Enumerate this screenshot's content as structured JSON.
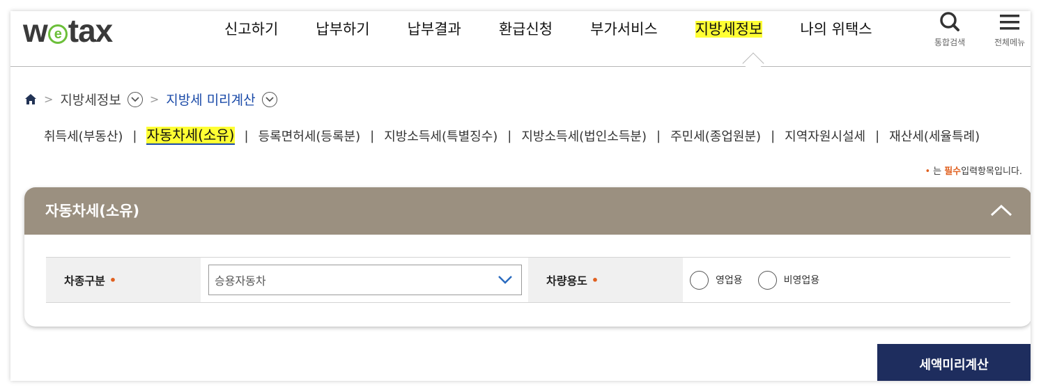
{
  "logo": {
    "pre": "w",
    "mid": "e",
    "post": "tax"
  },
  "gnb": [
    {
      "label": "신고하기",
      "active": false
    },
    {
      "label": "납부하기",
      "active": false
    },
    {
      "label": "납부결과",
      "active": false
    },
    {
      "label": "환급신청",
      "active": false
    },
    {
      "label": "부가서비스",
      "active": false
    },
    {
      "label": "지방세정보",
      "active": true
    },
    {
      "label": "나의 위택스",
      "active": false
    }
  ],
  "util": {
    "search_label": "통합검색",
    "menu_label": "전체메뉴"
  },
  "breadcrumb": {
    "level1": "지방세정보",
    "level2": "지방세 미리계산"
  },
  "subtabs": [
    "취득세(부동산)",
    "자동차세(소유)",
    "등록면허세(등록분)",
    "지방소득세(특별징수)",
    "지방소득세(법인소득분)",
    "주민세(종업원분)",
    "지역자원시설세",
    "재산세(세율특례)"
  ],
  "active_subtab": 1,
  "required_note": {
    "dot": "•",
    "pre": "는",
    "bold": "필수",
    "post": "입력항목입니다."
  },
  "panel": {
    "title": "자동차세(소유)",
    "vehicle_type_label": "차종구분",
    "vehicle_type_value": "승용자동차",
    "usage_label": "차량용도",
    "usage_options": [
      "영업용",
      "비영업용"
    ],
    "required_mark": "•"
  },
  "calc_button": "세액미리계산",
  "colors": {
    "accent": "#1a4aa8",
    "panel_header": "#9b9080",
    "button": "#1e2d5e",
    "required": "#e0601f",
    "highlight": "#ffff33"
  }
}
